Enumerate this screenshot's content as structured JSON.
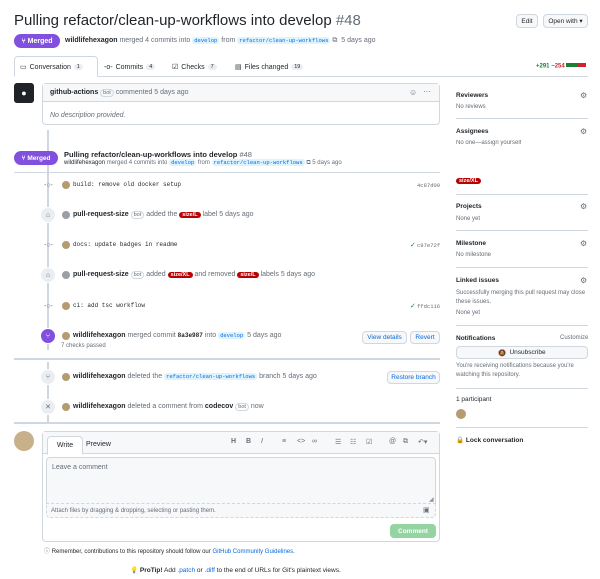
{
  "header": {
    "title": "Pulling refactor/clean-up-workflows into develop",
    "number": "#48",
    "edit_label": "Edit",
    "open_with_label": "Open with",
    "status": "Merged",
    "author": "wildlifehexagon",
    "merge_text": "merged 4 commits into",
    "base_branch": "develop",
    "from_text": "from",
    "head_branch": "refactor/clean-up-workflows",
    "time": "5 days ago"
  },
  "tabs": [
    {
      "label": "Conversation",
      "count": "1"
    },
    {
      "label": "Commits",
      "count": "4"
    },
    {
      "label": "Checks",
      "count": "7"
    },
    {
      "label": "Files changed",
      "count": "19"
    }
  ],
  "diffstat": {
    "added": "+291",
    "removed": "−254"
  },
  "first_comment": {
    "author": "github-actions",
    "bot": "bot",
    "time": "commented 5 days ago",
    "body": "No description provided."
  },
  "merged_event": {
    "status": "Merged",
    "title": "Pulling refactor/clean-up-workflows into develop",
    "number": "#48",
    "author": "wildlifehexagon",
    "text": "merged 4 commits into",
    "base": "develop",
    "from": "from",
    "head": "refactor/clean-up-workflows",
    "time": "5 days ago"
  },
  "timeline": {
    "commit1": {
      "msg": "build: remove old docker setup",
      "sha": "4c87d09"
    },
    "label_event1": {
      "actor": "pull-request-size",
      "bot": "bot",
      "text": "added the",
      "label": "size/L",
      "suffix": "label 5 days ago"
    },
    "commit2": {
      "msg": "docs: update badges in readme",
      "sha": "c97e72f"
    },
    "label_event2": {
      "actor": "pull-request-size",
      "bot": "bot",
      "text": "added",
      "label_added": "size/XL",
      "mid": "and removed",
      "label_removed": "size/L",
      "suffix": "labels 5 days ago"
    },
    "commit3": {
      "msg": "ci: add tsc workflow",
      "sha": "ffdc116"
    },
    "merge_commit": {
      "author": "wildlifehexagon",
      "text": "merged commit",
      "sha": "8a3e987",
      "into": "into",
      "branch": "develop",
      "time": "5 days ago",
      "checks": "7 checks passed",
      "view_details": "View details",
      "revert": "Revert"
    },
    "branch_deleted": {
      "author": "wildlifehexagon",
      "text": "deleted the",
      "branch": "refactor/clean-up-workflows",
      "suffix": "branch 5 days ago",
      "restore": "Restore branch"
    },
    "comment_deleted": {
      "author": "wildlifehexagon",
      "text": "deleted a comment from",
      "target": "codecov",
      "bot": "bot",
      "time": "now"
    }
  },
  "editor": {
    "tab_write": "Write",
    "tab_preview": "Preview",
    "placeholder": "Leave a comment",
    "attach": "Attach files by dragging & dropping, selecting or pasting them.",
    "submit": "Comment",
    "guidelines_prefix": "Remember, contributions to this repository should follow our",
    "guidelines_link": "GitHub Community Guidelines",
    "guidelines_suffix": "."
  },
  "protip": {
    "label": "ProTip!",
    "text1": "Add",
    "patch": ".patch",
    "or": "or",
    "diff": ".diff",
    "text2": "to the end of URLs for Git's plaintext views."
  },
  "sidebar": {
    "reviewers_title": "Reviewers",
    "reviewers_value": "No reviews",
    "assignees_title": "Assignees",
    "assignees_value": "No one—assign yourself",
    "label": "size/XL",
    "projects_title": "Projects",
    "projects_value": "None yet",
    "milestone_title": "Milestone",
    "milestone_value": "No milestone",
    "linked_title": "Linked issues",
    "linked_desc": "Successfully merging this pull request may close these issues.",
    "linked_value": "None yet",
    "notifications_title": "Notifications",
    "customize": "Customize",
    "unsubscribe": "Unsubscribe",
    "notif_desc": "You're receiving notifications because you're watching this repository.",
    "participants": "1 participant",
    "lock": "Lock conversation"
  },
  "colors": {
    "merged": "#8250df",
    "label_l": "#b60205",
    "label_xl": "#b60205",
    "green": "#1a7f37",
    "red": "#cf222e"
  }
}
